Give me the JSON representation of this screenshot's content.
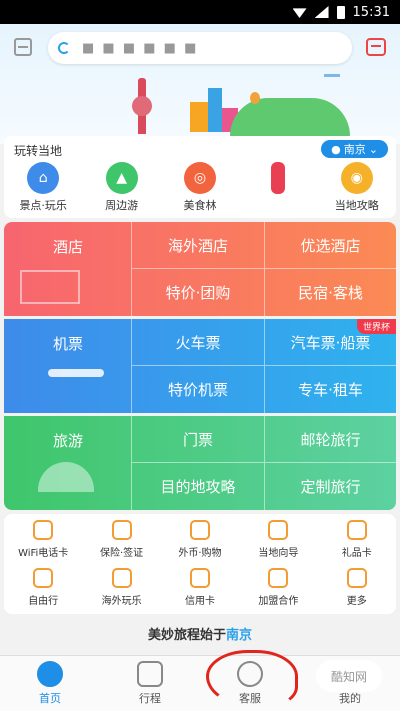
{
  "status_bar": {
    "time": "15:31"
  },
  "header": {
    "search_text": "■ ■ ■ ■ ■ ■",
    "scan_icon": "scan-icon",
    "message_icon": "message-icon"
  },
  "local": {
    "title": "玩转当地",
    "city": "南京",
    "items": [
      {
        "label": "景点·玩乐",
        "icon": "attraction-icon",
        "color": "#3e8bea"
      },
      {
        "label": "周边游",
        "icon": "mountain-icon",
        "color": "#3fc66b"
      },
      {
        "label": "美食林",
        "icon": "food-icon",
        "color": "#f2643d"
      },
      {
        "label": "",
        "icon": "scroll-icon",
        "color": "#e83f52"
      },
      {
        "label": "当地攻略",
        "icon": "location-icon",
        "color": "#f6b12a"
      }
    ]
  },
  "grid": {
    "row1": {
      "main": "酒店",
      "c1t": "海外酒店",
      "c2t": "优选酒店",
      "c1b": "特价·团购",
      "c2b": "民宿·客栈"
    },
    "row2": {
      "main": "机票",
      "c1t": "火车票",
      "c2t": "汽车票·船票",
      "badge": "世界杯",
      "c1b": "特价机票",
      "c2b": "专车·租车"
    },
    "row3": {
      "main": "旅游",
      "c1t": "门票",
      "c2t": "邮轮旅行",
      "c1b": "目的地攻略",
      "c2b": "定制旅行"
    }
  },
  "services": {
    "row1": [
      {
        "label": "WiFi电话卡",
        "icon": "wifi-icon"
      },
      {
        "label": "保险·签证",
        "icon": "shield-icon"
      },
      {
        "label": "外币·购物",
        "icon": "currency-icon"
      },
      {
        "label": "当地向导",
        "icon": "guide-icon"
      },
      {
        "label": "礼品卡",
        "icon": "gift-card-icon"
      }
    ],
    "row2": [
      {
        "label": "自由行",
        "icon": "backpack-icon"
      },
      {
        "label": "海外玩乐",
        "icon": "fun-icon"
      },
      {
        "label": "信用卡",
        "icon": "credit-card-icon"
      },
      {
        "label": "加盟合作",
        "icon": "handshake-icon"
      },
      {
        "label": "更多",
        "icon": "more-icon"
      }
    ]
  },
  "slogan": {
    "text": "美妙旅程始于",
    "city": "南京"
  },
  "bottom_nav": [
    {
      "label": "首页",
      "icon": "home-icon",
      "active": true
    },
    {
      "label": "行程",
      "icon": "calendar-icon"
    },
    {
      "label": "客服",
      "icon": "headset-icon"
    },
    {
      "label": "我的",
      "icon": "profile-icon"
    }
  ],
  "watermark": "酷知网"
}
